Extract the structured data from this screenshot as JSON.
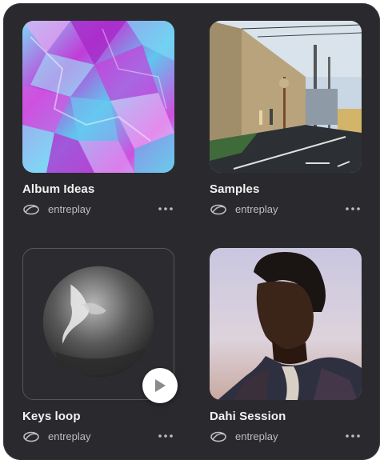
{
  "cards": [
    {
      "title": "Album Ideas",
      "brand": "entreplay",
      "thumbnail": "holographic-foil-artwork"
    },
    {
      "title": "Samples",
      "brand": "entreplay",
      "thumbnail": "street-photo"
    },
    {
      "title": "Keys loop",
      "brand": "entreplay",
      "thumbnail": "swimmer-circle-photo"
    },
    {
      "title": "Dahi Session",
      "brand": "entreplay",
      "thumbnail": "portrait-photo"
    }
  ],
  "icons": {
    "brand": "entreplay-logo-icon",
    "more": "more-horizontal-icon",
    "play": "play-icon"
  },
  "colors": {
    "panel_bg": "#2a2a2e",
    "title": "#f2f2f2",
    "meta": "#bdbdc2",
    "foil_primary": "#c23bd8",
    "foil_secondary": "#6fd3f0"
  }
}
